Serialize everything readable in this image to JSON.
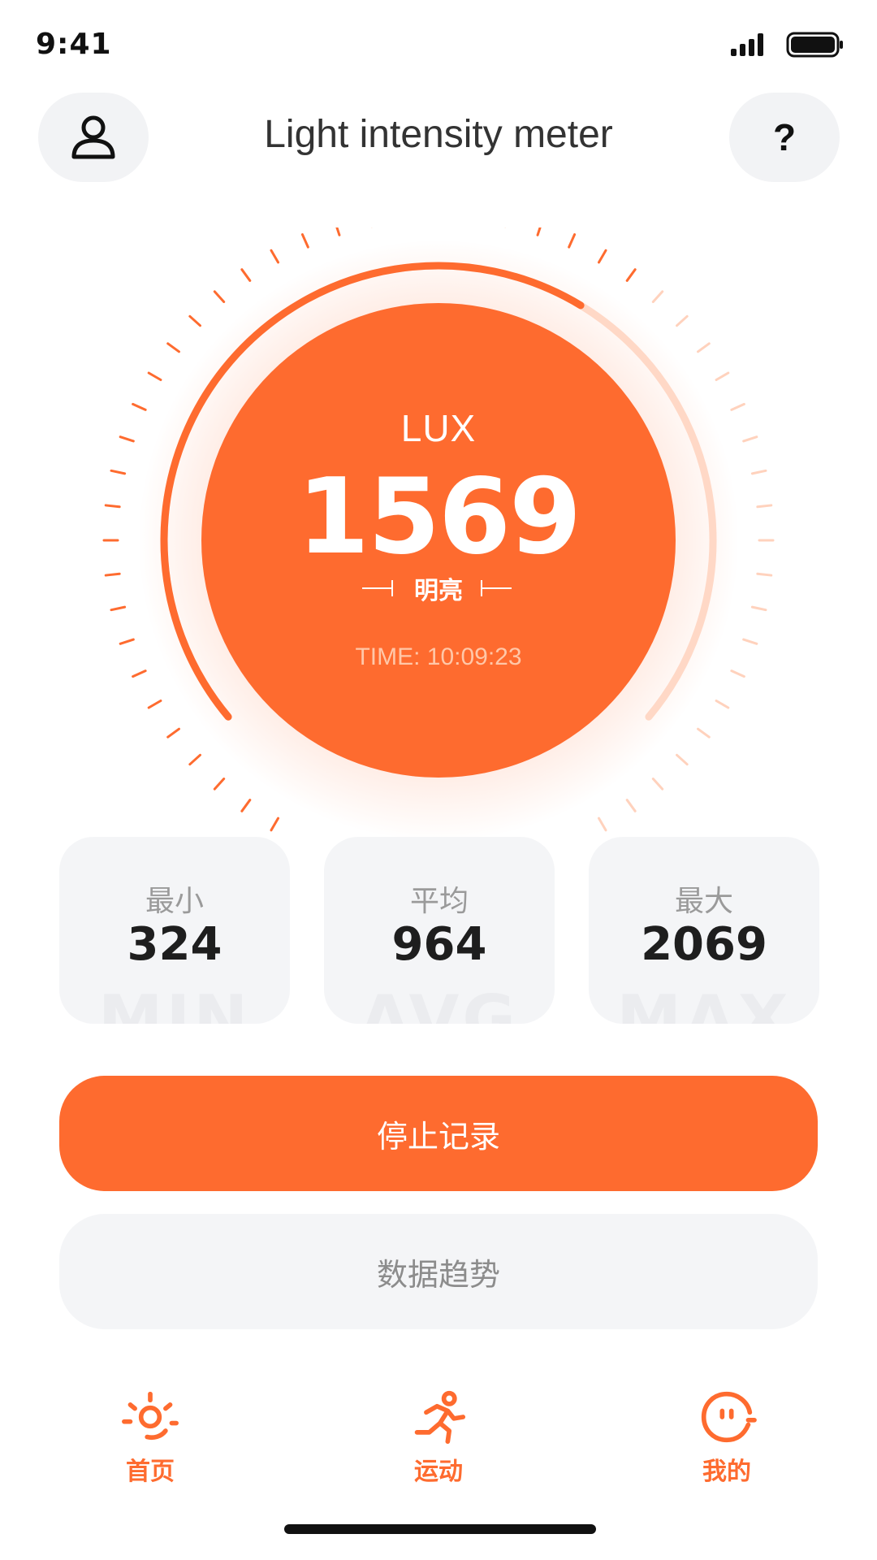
{
  "status_bar": {
    "time": "9:41"
  },
  "header": {
    "title": "Light intensity meter",
    "help_label": "?"
  },
  "gauge": {
    "unit": "LUX",
    "value": "1569",
    "status": "明亮",
    "time": "TIME: 10:09:23",
    "level_fraction": 0.62,
    "accent_color": "#fe6b2f"
  },
  "stats": [
    {
      "label": "最小",
      "value": "324",
      "watermark": "MIN"
    },
    {
      "label": "平均",
      "value": "964",
      "watermark": "AVG"
    },
    {
      "label": "最大",
      "value": "2069",
      "watermark": "MAX"
    }
  ],
  "actions": {
    "primary_label": "停止记录",
    "secondary_label": "数据趋势"
  },
  "tabbar": [
    {
      "label": "首页",
      "icon": "sun-icon"
    },
    {
      "label": "运动",
      "icon": "running-icon"
    },
    {
      "label": "我的",
      "icon": "smile-face-icon"
    }
  ]
}
